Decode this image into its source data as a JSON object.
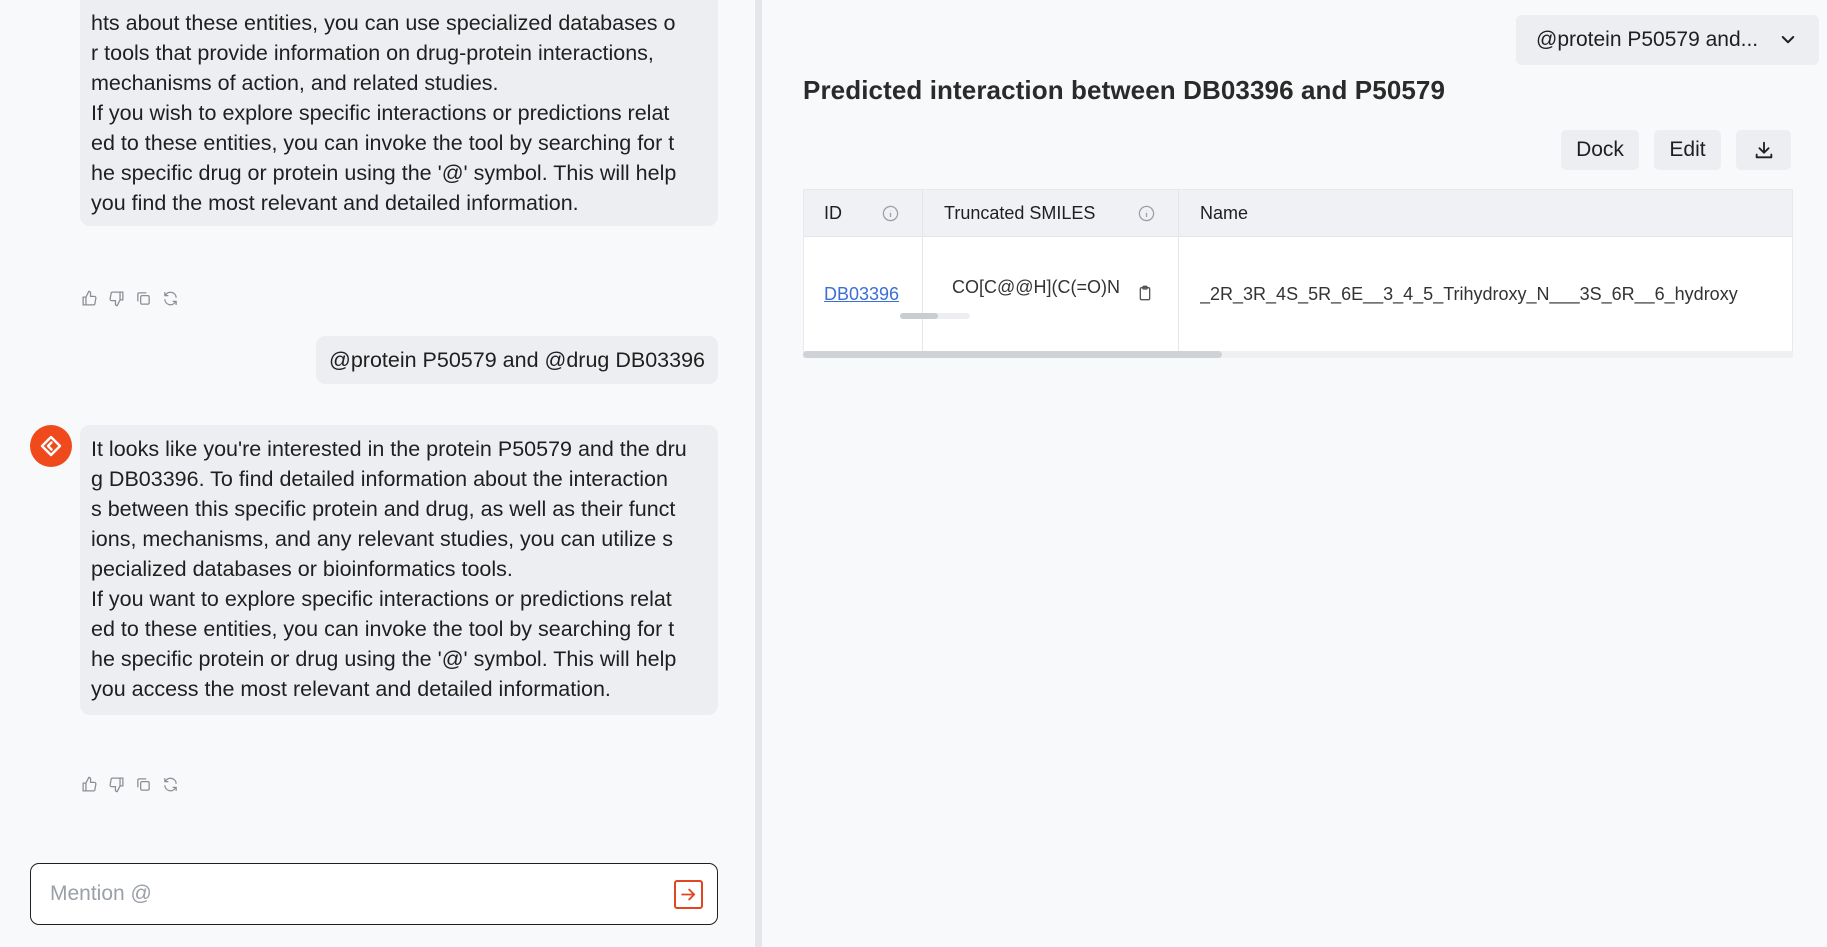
{
  "chat": {
    "messages": [
      {
        "role": "assistant",
        "lines": [
          "hts about these entities, you can use specialized databases o",
          "r tools that provide information on drug-protein interactions,",
          "mechanisms of action, and related studies.",
          "If you wish to explore specific interactions or predictions relat",
          "ed to these entities, you can invoke the tool by searching for t",
          "he specific drug or protein using the '@' symbol. This will help",
          "you find the most relevant and detailed information."
        ]
      },
      {
        "role": "user",
        "text": "@protein P50579 and @drug DB03396"
      },
      {
        "role": "assistant",
        "lines": [
          "It looks like you're interested in the protein P50579 and the dru",
          "g DB03396. To find detailed information about the interaction",
          "s between this specific protein and drug, as well as their funct",
          "ions, mechanisms, and any relevant studies, you can utilize s",
          "pecialized databases or bioinformatics tools.",
          "If you want to explore specific interactions or predictions relat",
          "ed to these entities, you can invoke the tool by searching for t",
          "he specific protein or drug using the '@' symbol. This will help",
          "you access the most relevant and detailed information."
        ]
      }
    ],
    "action_icons": [
      "thumbs-up-icon",
      "thumbs-down-icon",
      "copy-icon",
      "regenerate-icon"
    ],
    "composer": {
      "placeholder": "Mention @"
    },
    "accent_color": "#f04a1c"
  },
  "panel": {
    "context_select": "@protein P50579 and...",
    "title": "Predicted interaction between DB03396 and P50579",
    "buttons": {
      "dock": "Dock",
      "edit": "Edit"
    },
    "table": {
      "columns": [
        "ID",
        "Truncated SMILES",
        "Name"
      ],
      "rows": [
        {
          "id": "DB03396",
          "smiles": "CO[C@@H](C(=O)N",
          "name": "_2R_3R_4S_5R_6E__3_4_5_Trihydroxy_N___3S_6R__6_hydroxy"
        }
      ]
    }
  }
}
